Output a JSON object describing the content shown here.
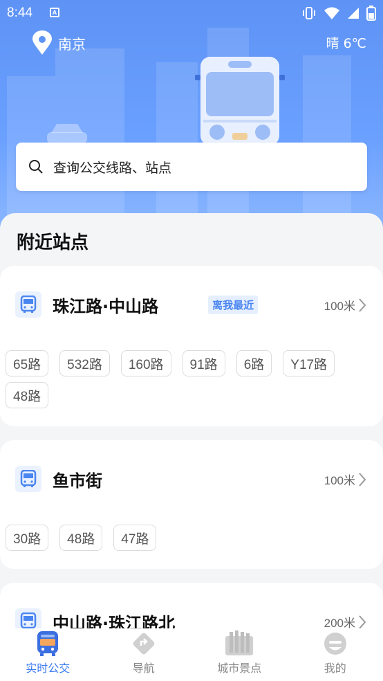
{
  "status_bar": {
    "time": "8:44",
    "notif_letter": "A"
  },
  "header": {
    "city": "南京",
    "weather": "晴 6℃"
  },
  "search": {
    "placeholder": "查询公交线路、站点"
  },
  "nearby": {
    "title": "附近站点",
    "stops": [
      {
        "name": "珠江路·中山路",
        "badge": "离我最近",
        "distance": "100米",
        "routes": [
          "65路",
          "532路",
          "160路",
          "91路",
          "6路",
          "Y17路",
          "48路"
        ]
      },
      {
        "name": "鱼市街",
        "distance": "100米",
        "routes": [
          "30路",
          "48路",
          "47路"
        ]
      },
      {
        "name": "中山路·珠江路北",
        "distance": "200米"
      }
    ]
  },
  "bottom_nav": [
    {
      "label": "实时公交",
      "icon": "bus-icon",
      "active": true
    },
    {
      "label": "导航",
      "icon": "navigation-icon",
      "active": false
    },
    {
      "label": "城市景点",
      "icon": "city-attractions-icon",
      "active": false
    },
    {
      "label": "我的",
      "icon": "profile-icon",
      "active": false
    }
  ],
  "colors": {
    "accent": "#3b7bf0",
    "hero": "#6aa0ff",
    "badge_bg": "#e6efff"
  }
}
